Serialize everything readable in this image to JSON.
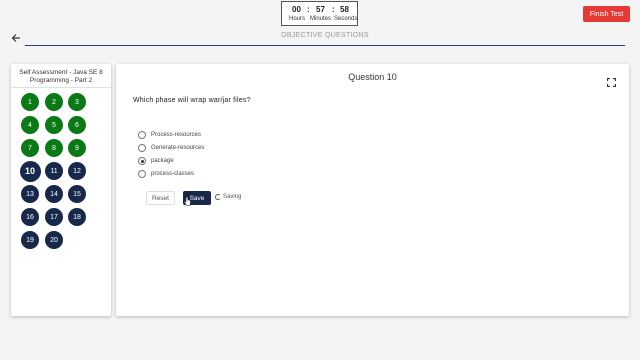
{
  "timer": {
    "hours": "00",
    "minutes": "57",
    "seconds": "58",
    "sep1": ":",
    "sep2": ":",
    "hours_label": "Hours",
    "minutes_label": "Minutes",
    "seconds_label": "Seconds"
  },
  "header": {
    "finish_label": "Finish Test",
    "section_title": "OBJECTIVE QUESTIONS",
    "back_icon": "arrow-left-icon"
  },
  "sidebar": {
    "title": "Self Assessment - Java SE 8 Programming - Part 2",
    "questions": [
      {
        "num": "1",
        "state": "answered"
      },
      {
        "num": "2",
        "state": "answered"
      },
      {
        "num": "3",
        "state": "answered"
      },
      {
        "num": "4",
        "state": "answered"
      },
      {
        "num": "5",
        "state": "answered"
      },
      {
        "num": "6",
        "state": "answered"
      },
      {
        "num": "7",
        "state": "answered"
      },
      {
        "num": "8",
        "state": "answered"
      },
      {
        "num": "9",
        "state": "answered"
      },
      {
        "num": "10",
        "state": "current"
      },
      {
        "num": "11",
        "state": "unanswered"
      },
      {
        "num": "12",
        "state": "unanswered"
      },
      {
        "num": "13",
        "state": "unanswered"
      },
      {
        "num": "14",
        "state": "unanswered"
      },
      {
        "num": "15",
        "state": "unanswered"
      },
      {
        "num": "16",
        "state": "unanswered"
      },
      {
        "num": "17",
        "state": "unanswered"
      },
      {
        "num": "18",
        "state": "unanswered"
      },
      {
        "num": "19",
        "state": "unanswered"
      },
      {
        "num": "20",
        "state": "unanswered"
      }
    ]
  },
  "question": {
    "header": "Question 10",
    "text": "Which phase will wrap war/jar files?",
    "options": [
      "Process-resources",
      "Generate-resources",
      "package",
      "process-classes"
    ],
    "selected_index": 2
  },
  "actions": {
    "reset_label": "Reset",
    "save_label": "Save",
    "saving_label": "Saving"
  },
  "colors": {
    "answered": "#0a7a17",
    "unanswered": "#17284b",
    "finish": "#e53935"
  }
}
